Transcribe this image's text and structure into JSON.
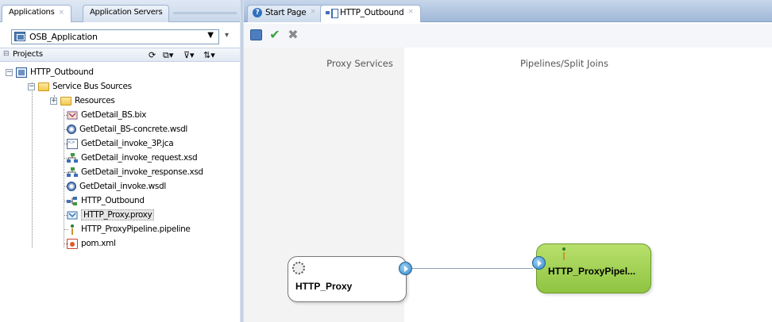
{
  "left_tabs": [
    {
      "label": "Applications",
      "active": true
    },
    {
      "label": "Application Servers",
      "active": false
    }
  ],
  "app_selector": {
    "value": "OSB_Application"
  },
  "projects_header": {
    "label": "Projects"
  },
  "tree": {
    "project": "HTTP_Outbound",
    "sources_folder": "Service Bus Sources",
    "resources_folder": "Resources",
    "files": [
      {
        "label": "GetDetail_BS.bix",
        "icon": "business-service-icon"
      },
      {
        "label": "GetDetail_BS-concrete.wsdl",
        "icon": "wsdl-icon"
      },
      {
        "label": "GetDetail_invoke_3P.jca",
        "icon": "jca-icon"
      },
      {
        "label": "GetDetail_invoke_request.xsd",
        "icon": "xsd-icon"
      },
      {
        "label": "GetDetail_invoke_response.xsd",
        "icon": "xsd-icon"
      },
      {
        "label": "GetDetail_invoke.wsdl",
        "icon": "wsdl-icon"
      },
      {
        "label": "HTTP_Outbound",
        "icon": "overview-icon"
      },
      {
        "label": "HTTP_Proxy.proxy",
        "icon": "proxy-service-icon",
        "selected": true
      },
      {
        "label": "HTTP_ProxyPipeline.pipeline",
        "icon": "pipeline-icon"
      },
      {
        "label": "pom.xml",
        "icon": "xml-file-icon"
      }
    ]
  },
  "editor_tabs": [
    {
      "label": "Start Page",
      "active": false
    },
    {
      "label": "HTTP_Outbound",
      "active": true
    }
  ],
  "canvas": {
    "lane_proxy_title": "Proxy Services",
    "lane_pipeline_title": "Pipelines/Split Joins",
    "proxy_node": {
      "name": "HTTP_Proxy"
    },
    "pipeline_node": {
      "name": "HTTP_ProxyPipel..."
    }
  },
  "colors": {
    "pipeline_green": "#8fc441",
    "port_blue": "#2f86c6",
    "tab_blue": "#9fb8d8"
  }
}
